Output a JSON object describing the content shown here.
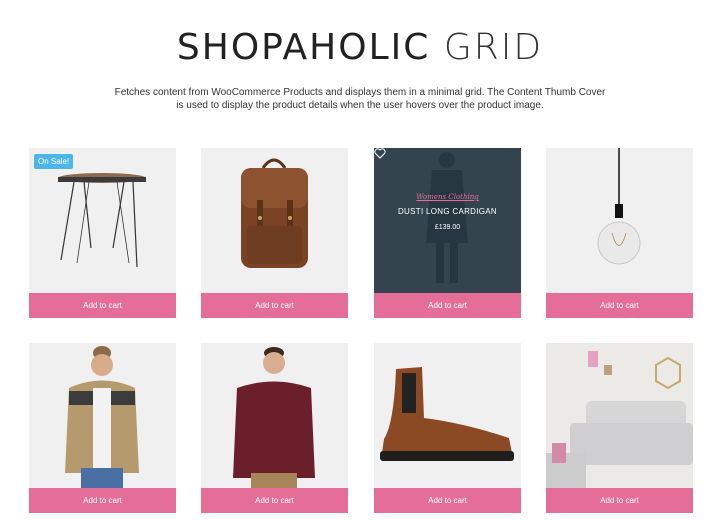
{
  "header": {
    "title_strong": "SHOPAHOLIC",
    "title_light": "GRID",
    "description": "Fetches content from WooCommerce Products and displays them in a minimal grid. The Content Thumb Cover is used to display the product details when the user hovers over the product image."
  },
  "products": [
    {
      "badge": "On Sale!",
      "image": "side-table",
      "cart_label": "Add to cart"
    },
    {
      "image": "leather-backpack",
      "cart_label": "Add to cart"
    },
    {
      "image": "woman-cardigan",
      "cart_label": "Add to cart",
      "hover": {
        "category": "Womens Clothing",
        "name": "DUSTI LONG CARDIGAN",
        "price": "£139.00",
        "icon": "heart-icon"
      }
    },
    {
      "image": "pendant-bulb",
      "cart_label": "Add to cart"
    },
    {
      "image": "man-jacket",
      "cart_label": "Add to cart"
    },
    {
      "image": "man-sweater",
      "cart_label": "Add to cart"
    },
    {
      "image": "chelsea-boot",
      "cart_label": "Add to cart"
    },
    {
      "image": "bedroom",
      "cart_label": "Add to cart"
    }
  ],
  "colors": {
    "cart_button": "#e46e97",
    "badge": "#4ab6ec",
    "overlay": "#263742",
    "thumb_bg": "#f0f0f0"
  }
}
